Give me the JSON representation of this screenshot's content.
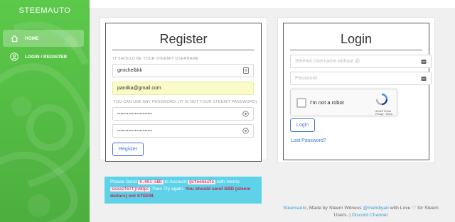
{
  "sidebar": {
    "brand": "STEEMAUTO",
    "items": [
      {
        "label": "HOME",
        "icon": "home-icon"
      },
      {
        "label": "LOGIN / REGISTER",
        "icon": "user-icon"
      }
    ]
  },
  "register": {
    "title": "Register",
    "username_hint": "IT SHOULD BE YOUR STEEMIT USERNAME:",
    "username_value": "gmichelbkk",
    "email_value": "pantika@gmail.com",
    "password_hint": "YOU CAN USE ANY PASSWORD. (IT IS NOT YOUR STEEMIT PASSWORD)",
    "password_value": "••••••••••••••••••••••",
    "confirm_value": "••••••••••••••••••••••",
    "button": "Register"
  },
  "login": {
    "title": "Login",
    "username_placeholder": "Steemit Username without @",
    "password_placeholder": "Password",
    "recaptcha_label": "I'm not a robot",
    "recaptcha_brand": "reCAPTCHA",
    "recaptcha_terms": "Privacy - Terms",
    "button": "Login",
    "lost_password": "Lost Password?"
  },
  "notice": {
    "p1": "Please Send ",
    "amount": "0.001 SBD",
    "p2": " to Account ",
    "account": "@steemauto",
    "p3": " with memo ",
    "memo": "sxoazf6Ttjh0Dpc",
    "p4": " Then Try again. ",
    "warning": "You should send SBD (steem dollars) not STEEM."
  },
  "footer": {
    "site": "Steemauto",
    "p1": ", Made by Steem Witness ",
    "author": "@mahdiyari",
    "p2": " with Love ",
    "heart": "♡",
    "p3": " for Steem Users. | ",
    "discord": "Discord Channel"
  },
  "colors": {
    "sidebar": "#4caf3e",
    "accent": "#4a73d8",
    "notice": "#5ed2e8",
    "warning": "#c7254e"
  }
}
